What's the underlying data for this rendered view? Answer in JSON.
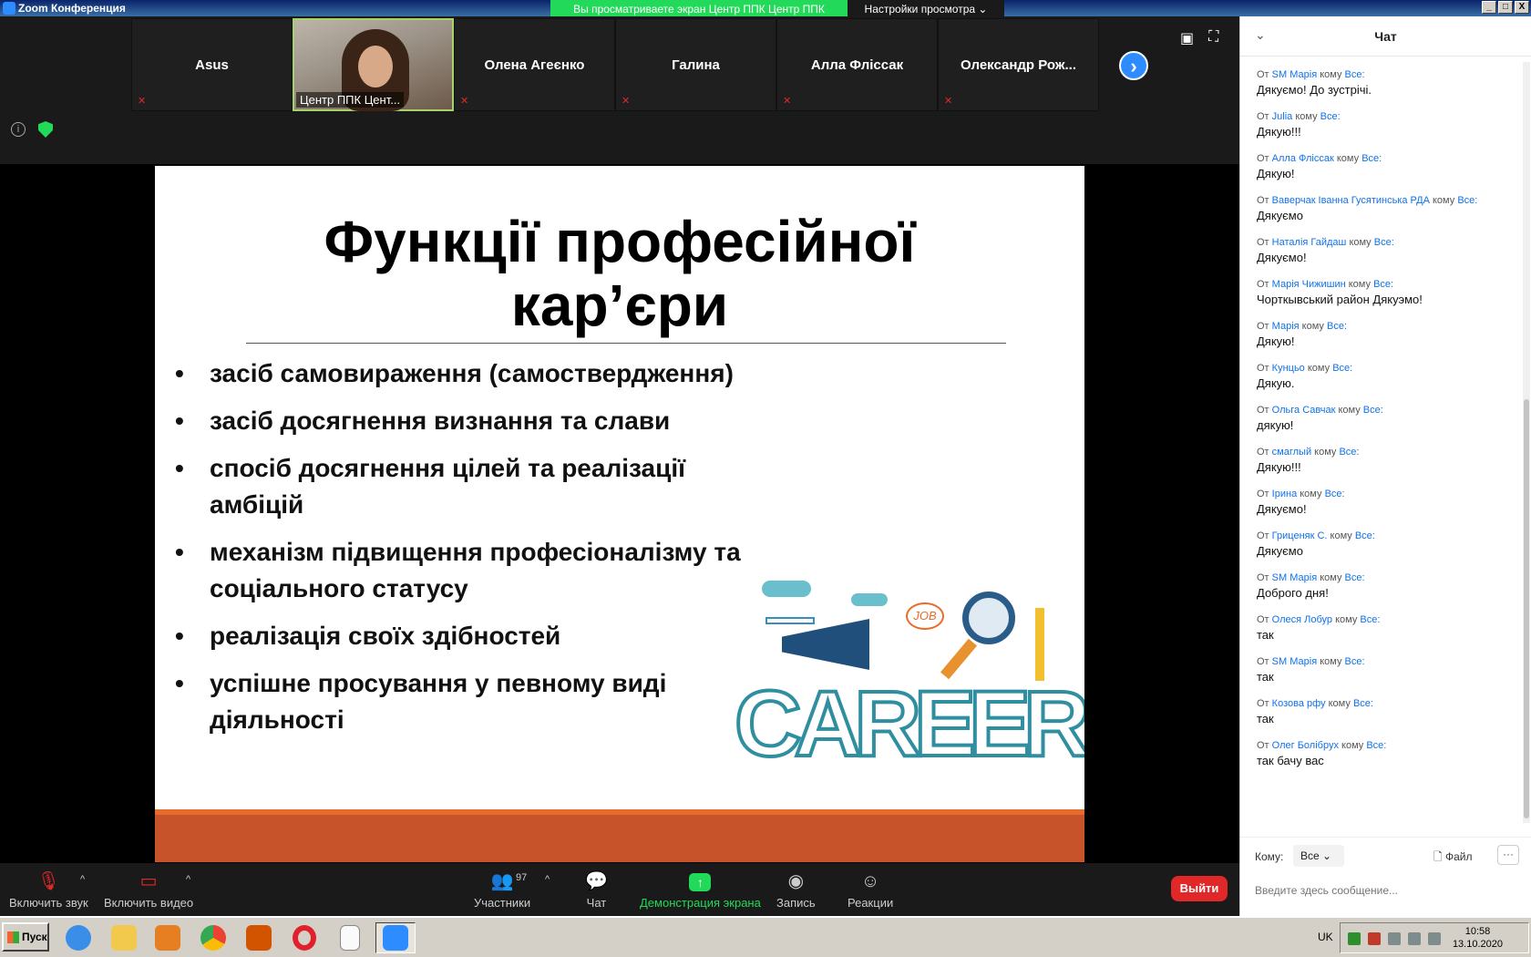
{
  "window": {
    "title": "Zoom Конференция",
    "buttons": [
      "_",
      "□",
      "X"
    ]
  },
  "share_banner": "Вы просматриваете экран Центр ППК Центр ППК",
  "view_options": "Настройки просмотра ⌄",
  "participants": [
    {
      "name": "Asus",
      "muted": true
    },
    {
      "name": "Центр ППК Цент...",
      "video": true
    },
    {
      "name": "Олена Агеєнко",
      "muted": true
    },
    {
      "name": "Галина",
      "muted": true
    },
    {
      "name": "Алла Фліссак",
      "muted": true
    },
    {
      "name": "Олександр  Рож...",
      "muted": true
    }
  ],
  "slide": {
    "title_line1": "Функції професійної",
    "title_line2": "кар’єри",
    "bullets": [
      "засіб самовираження (самоствердження)",
      "засіб досягнення визнання та слави",
      "спосіб досягнення цілей та реалізації амбіцій",
      "механізм підвищення професіоналізму та соціального статусу",
      "реалізація своїх здібностей",
      "успішне просування у певному виді діяльності"
    ],
    "art_text": "CAREER",
    "art_bubble": "JOB",
    "accent_color": "#e96b2c",
    "footer_color": "#c7532b"
  },
  "toolbar": {
    "audio": "Включить звук",
    "video": "Включить видео",
    "participants": "Участники",
    "participants_count": "97",
    "chat": "Чат",
    "share": "Демонстрация экрана",
    "record": "Запись",
    "reactions": "Реакции",
    "leave": "Выйти"
  },
  "chat": {
    "title": "Чат",
    "from_prefix": "От",
    "to_word": "кому",
    "to_all": "Все:",
    "messages": [
      {
        "from": "SM Марія",
        "text": "Дякуємо! До зустрічі."
      },
      {
        "from": "Julia",
        "text": "Дякую!!!"
      },
      {
        "from": "Алла Фліссак",
        "text": "Дякую!"
      },
      {
        "from": "Ваверчак Іванна Гусятинська РДА",
        "text": "Дякуємо"
      },
      {
        "from": "Наталія Гайдаш",
        "text": "Дякуємо!"
      },
      {
        "from": "Марія Чижишин",
        "text": "Чорткывський район Дякуэмо!"
      },
      {
        "from": "Марія",
        "text": "Дякую!"
      },
      {
        "from": "Кунцьо",
        "text": "Дякую."
      },
      {
        "from": "Ольга Савчак",
        "text": "дякую!"
      },
      {
        "from": "смаглый",
        "text": "Дякую!!!"
      },
      {
        "from": "Ірина",
        "text": "Дякуємо!"
      },
      {
        "from": "Гриценяк С.",
        "text": "Дякуємо"
      },
      {
        "from": "SM Марія",
        "text": "Доброго дня!"
      },
      {
        "from": "Олеся Лобур",
        "text": "так"
      },
      {
        "from": "SM Марія",
        "text": "так"
      },
      {
        "from": "Козова рфу",
        "text": "так"
      },
      {
        "from": "Олег Болібрух",
        "text": "так бачу вас"
      }
    ],
    "to_label": "Кому:",
    "to_value": "Все",
    "file_label": "Файл",
    "more_label": "···",
    "input_placeholder": "Введите здесь сообщение..."
  },
  "taskbar": {
    "start": "Пуск",
    "lang": "UK",
    "time": "10:58",
    "date": "13.10.2020"
  }
}
